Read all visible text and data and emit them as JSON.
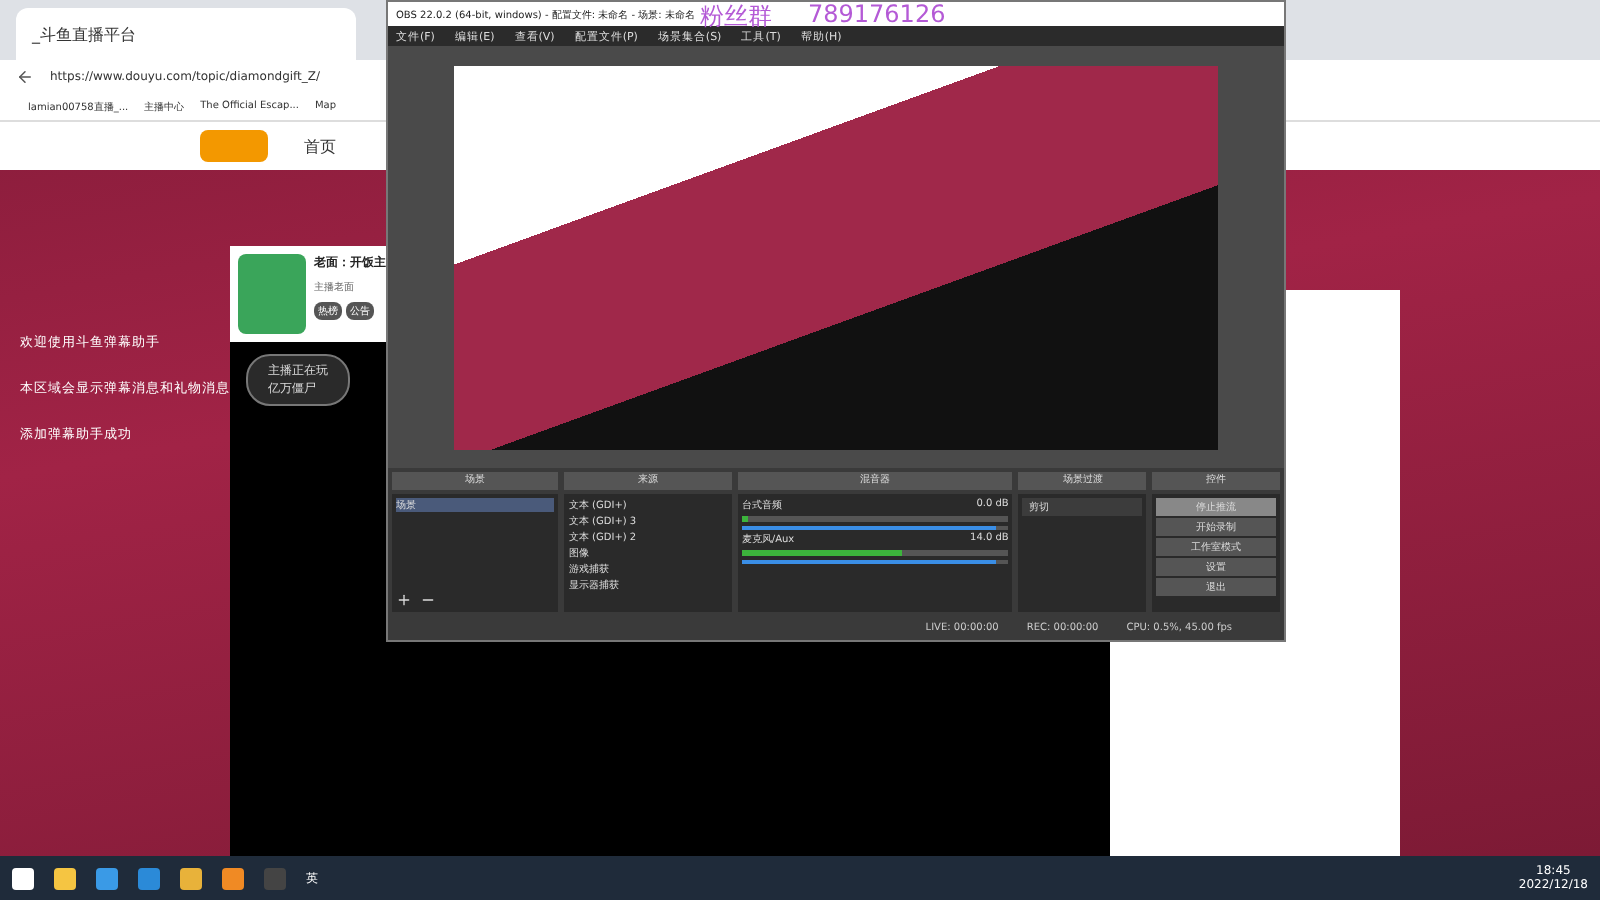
{
  "browser": {
    "tab_title": "_斗鱼直播平台",
    "url": "https://www.douyu.com/topic/diamondgift_Z/",
    "bookmarks": [
      "lamian00758直播_...",
      "主播中心",
      "The Official Escap...",
      "Map"
    ],
    "nav": [
      "首页"
    ],
    "chat_messages": [
      "欢迎使用斗鱼弹幕助手",
      "本区域会显示弹幕消息和礼物消息",
      "添加弹幕助手成功"
    ],
    "streamer_card": {
      "title": "老面：开饭主",
      "name": "主播老面",
      "tabs": [
        "热榜",
        "公告"
      ]
    },
    "game_badge": {
      "label": "主播正在玩",
      "game": "亿万僵尸"
    }
  },
  "overlay_text": {
    "label": "粉丝群",
    "number": "789176126"
  },
  "obs": {
    "title": "OBS 22.0.2 (64-bit, windows) - 配置文件: 未命名 - 场景: 未命名",
    "menu": [
      "文件(F)",
      "编辑(E)",
      "查看(V)",
      "配置文件(P)",
      "场景集合(S)",
      "工具(T)",
      "帮助(H)"
    ],
    "docks": {
      "scenes": {
        "title": "场景",
        "items": [
          {
            "label": "场景",
            "selected": true
          }
        ]
      },
      "sources": {
        "title": "来源",
        "items": [
          "文本 (GDI+)",
          "文本 (GDI+) 3",
          "文本 (GDI+) 2",
          "图像",
          "游戏捕获",
          "显示器捕获"
        ]
      },
      "mixer": {
        "title": "混音器",
        "channels": [
          {
            "name": "台式音频",
            "reading": "0.0 dB",
            "level": 0.95
          },
          {
            "name": "麦克风/Aux",
            "reading": "14.0 dB",
            "level": 0.95
          }
        ]
      },
      "transitions": {
        "title": "场景过渡",
        "value": "剪切"
      },
      "controls": {
        "title": "控件",
        "buttons": [
          {
            "label": "停止推流",
            "selected": true
          },
          {
            "label": "开始录制",
            "selected": false
          },
          {
            "label": "工作室模式",
            "selected": false
          },
          {
            "label": "设置",
            "selected": false
          },
          {
            "label": "退出",
            "selected": false
          }
        ]
      }
    },
    "status": [
      "LIVE: 00:00:00",
      "REC: 00:00:00",
      "CPU: 0.5%, 45.00 fps"
    ]
  },
  "taskbar": {
    "ime": "英",
    "time": "18:45",
    "date": "2022/12/18"
  }
}
